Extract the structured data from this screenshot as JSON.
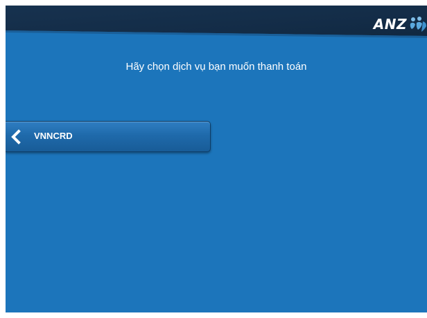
{
  "header": {
    "brand": "ANZ",
    "brand_icon": "anz-people-logo-icon"
  },
  "prompt": {
    "text": "Hãy chọn dịch vụ bạn muốn thanh toán"
  },
  "menu": {
    "items": [
      {
        "label": "VNNCRD",
        "icon": "chevron-left-icon"
      }
    ]
  },
  "colors": {
    "background": "#1c75bb",
    "header": "#132c47",
    "button": "#1f6aab",
    "text": "#ffffff"
  }
}
